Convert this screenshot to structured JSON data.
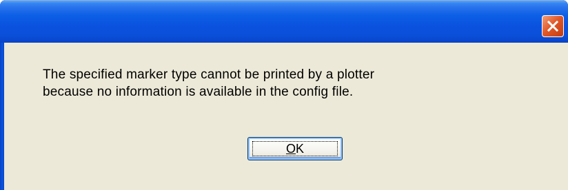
{
  "window": {
    "title": "",
    "close_icon": "close-icon",
    "accent_color": "#0a52df",
    "close_color": "#e25a2a"
  },
  "message": {
    "line1": "The specified marker type cannot be printed by a plotter",
    "line2": "because no information is available in the config file."
  },
  "buttons": {
    "ok": {
      "mnemonic": "O",
      "rest": "K"
    }
  }
}
